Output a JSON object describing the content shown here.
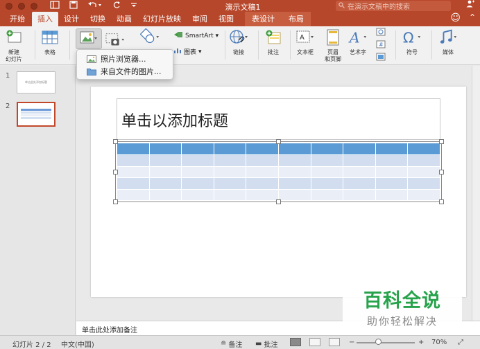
{
  "window": {
    "title": "演示文稿1",
    "search_placeholder": "在演示文稿中的搜索"
  },
  "tabs": [
    {
      "label": "开始"
    },
    {
      "label": "插入"
    },
    {
      "label": "设计"
    },
    {
      "label": "切换"
    },
    {
      "label": "动画"
    },
    {
      "label": "幻灯片放映"
    },
    {
      "label": "审阅"
    },
    {
      "label": "视图"
    },
    {
      "label": "表设计"
    },
    {
      "label": "布局"
    }
  ],
  "ribbon": {
    "new_slide": "新建\n幻灯片",
    "table": "表格",
    "smartart": "SmartArt",
    "chart": "图表",
    "link": "链接",
    "comment": "批注",
    "textbox": "文本框",
    "header_footer": "页眉\n和页脚",
    "wordart": "艺术字",
    "symbol": "符号",
    "media": "媒体"
  },
  "dropdown": {
    "items": [
      {
        "label": "照片浏览器..."
      },
      {
        "label": "来自文件的图片..."
      }
    ]
  },
  "thumbnails": [
    {
      "number": "1",
      "mini_title": "单击此处添加标题"
    },
    {
      "number": "2"
    }
  ],
  "slide": {
    "title_placeholder": "单击以添加标题",
    "table": {
      "rows": 5,
      "cols": 10
    }
  },
  "notes_placeholder": "单击此处添加备注",
  "status": {
    "slide_counter": "幻灯片 2 / 2",
    "language": "中文(中国)",
    "notes_label": "备注",
    "comments_label": "批注",
    "zoom": "70%",
    "zoom_level": 0.7
  },
  "watermark": {
    "main": "百科全说",
    "sub": "助你轻松解决"
  },
  "colors": {
    "accent": "#b7472a",
    "table_header": "#5b9bd5",
    "table_band_dark": "#d2deef",
    "table_band_light": "#eaeff7",
    "watermark_green": "#27a34b"
  }
}
